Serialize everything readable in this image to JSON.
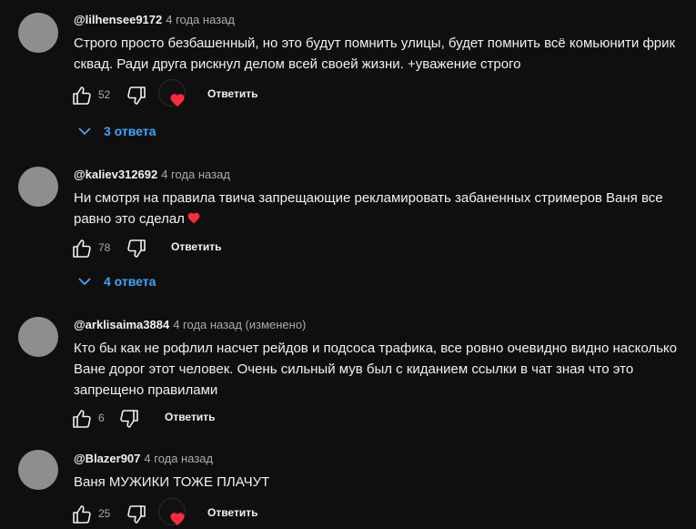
{
  "icons": {
    "like": "thumb-up-icon",
    "dislike": "thumb-down-icon",
    "heart": "heart-icon",
    "expand": "chevron-down-icon"
  },
  "colors": {
    "background": "#0f0f0f",
    "text": "#f1f1f1",
    "secondary": "#aaaaaa",
    "link": "#3ea6ff",
    "heart": "#ff2a3c"
  },
  "comments": [
    {
      "author": "@lilhensee9172",
      "time": "4 года назад",
      "text": "Строго просто безбашенный, но это будут помнить улицы, будет помнить всё комьюнити фрик сквад. Ради друга рискнул делом всей своей жизни. +уважение строго",
      "likes": "52",
      "reply_label": "Ответить",
      "replies_label": "3 ответа"
    },
    {
      "author": "@kaliev312692",
      "time": "4 года назад",
      "text": "Ни смотря на правила твича запрещающие рекламировать забаненных стримеров Ваня все равно это сделал",
      "likes": "78",
      "reply_label": "Ответить",
      "replies_label": "4 ответа"
    },
    {
      "author": "@arklisaima3884",
      "time": "4 года назад (изменено)",
      "text": "Кто бы как не рофлил насчет рейдов и подсоса трафика, все ровно очевидно  видно насколько Ване дорог этот человек. Очень сильный мув был с киданием ссылки в чат зная что это запрещено правилами",
      "likes": "6",
      "reply_label": "Ответить"
    },
    {
      "author": "@Blazer907",
      "time": "4 года назад",
      "text": "Ваня МУЖИКИ ТОЖЕ ПЛАЧУТ",
      "likes": "25",
      "reply_label": "Ответить"
    }
  ]
}
